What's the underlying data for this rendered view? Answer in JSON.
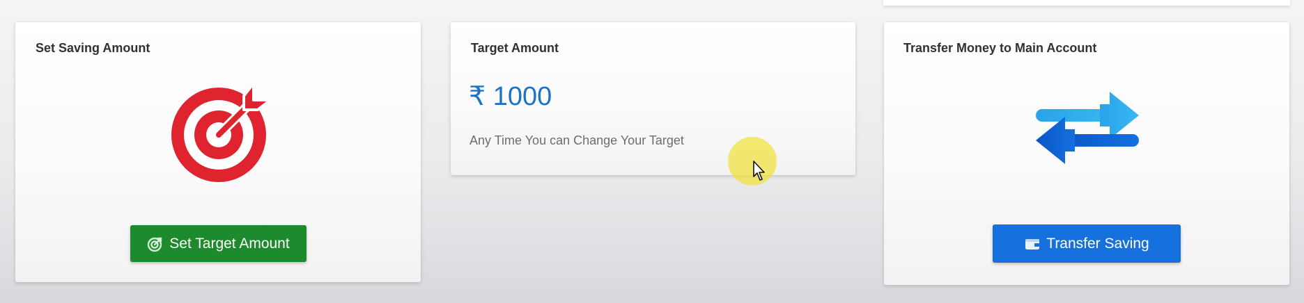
{
  "cards": {
    "set_saving": {
      "title": "Set Saving Amount",
      "icon": "target-icon",
      "button_label": "Set Target Amount",
      "button_icon": "target-arrow-icon"
    },
    "target_amount": {
      "title": "Target Amount",
      "amount": "₹ 1000",
      "note": "Any Time You can Change Your Target"
    },
    "transfer": {
      "title": "Transfer Money to Main Account",
      "icon": "transfer-arrows-icon",
      "button_label": "Transfer Saving",
      "button_icon": "wallet-icon"
    }
  },
  "colors": {
    "amount_blue": "#1a73c7",
    "green_button": "#1e8a2e",
    "blue_button": "#1670de",
    "target_red": "#e0242f"
  }
}
